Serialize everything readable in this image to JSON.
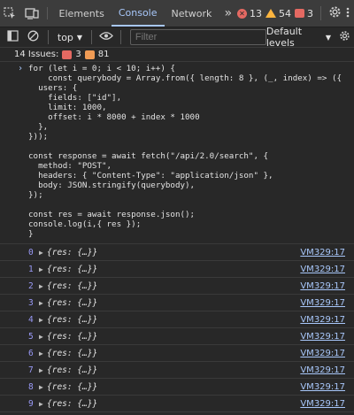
{
  "tabs": [
    "Elements",
    "Console",
    "Network"
  ],
  "active_tab": "Console",
  "more_tabs_glyph": "»",
  "status": {
    "errors": "13",
    "warnings": "54",
    "issues": "3"
  },
  "toolbar": {
    "context": "top",
    "filter_placeholder": "Filter",
    "levels": "Default levels"
  },
  "issues_bar": {
    "label": "14 Issues:",
    "errors": "3",
    "warnings": "81"
  },
  "code_lines": [
    "for (let i = 0; i < 10; i++) {",
    "    const querybody = Array.from({ length: 8 }, (_, index) => ({",
    "  users: {",
    "    fields: [\"id\"],",
    "    limit: 1000,",
    "    offset: i * 8000 + index * 1000",
    "  },",
    "}));",
    "",
    "const response = await fetch(\"/api/2.0/search\", {",
    "  method: \"POST\",",
    "  headers: { \"Content-Type\": \"application/json\" },",
    "  body: JSON.stringify(querybody),",
    "});",
    "",
    "const res = await response.json();",
    "console.log(i,{ res });",
    "}"
  ],
  "log_rows": [
    {
      "index": "0",
      "value": "{res: {…}}",
      "source": "VM329:17"
    },
    {
      "index": "1",
      "value": "{res: {…}}",
      "source": "VM329:17"
    },
    {
      "index": "2",
      "value": "{res: {…}}",
      "source": "VM329:17"
    },
    {
      "index": "3",
      "value": "{res: {…}}",
      "source": "VM329:17"
    },
    {
      "index": "4",
      "value": "{res: {…}}",
      "source": "VM329:17"
    },
    {
      "index": "5",
      "value": "{res: {…}}",
      "source": "VM329:17"
    },
    {
      "index": "6",
      "value": "{res: {…}}",
      "source": "VM329:17"
    },
    {
      "index": "7",
      "value": "{res: {…}}",
      "source": "VM329:17"
    },
    {
      "index": "8",
      "value": "{res: {…}}",
      "source": "VM329:17"
    },
    {
      "index": "9",
      "value": "{res: {…}}",
      "source": "VM329:17"
    }
  ],
  "colors": {
    "accent": "#a8c7fa",
    "error": "#e46962",
    "warning": "#fdb53f",
    "number": "#9a9af8",
    "string": "#f28b54"
  }
}
